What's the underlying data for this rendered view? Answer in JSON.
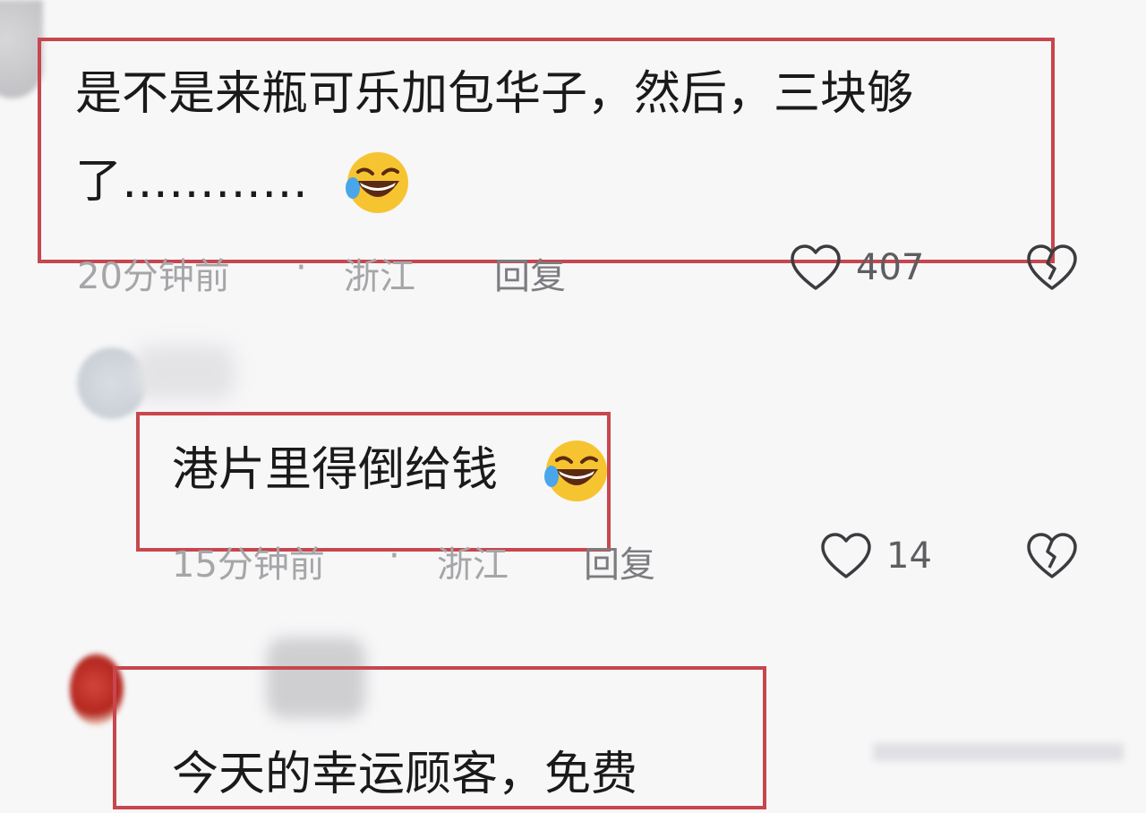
{
  "comments": [
    {
      "text_line1": "是不是来瓶可乐加包华子，然后，三块够",
      "text_line2": "了…………",
      "time": "20分钟前",
      "sep": "·",
      "location": "浙江",
      "reply": "回复",
      "likes": "407",
      "emoji": "laughing-crying-emoji"
    },
    {
      "text": "港片里得倒给钱",
      "time": "15分钟前",
      "sep": "·",
      "location": "浙江",
      "reply": "回复",
      "likes": "14",
      "emoji": "laughing-crying-emoji"
    },
    {
      "text": "今天的幸运顾客，免费"
    }
  ],
  "colors": {
    "highlight": "#c8464d",
    "meta": "#a6a6a9",
    "text": "#1a1a1a"
  },
  "icons": [
    "heart-outline-icon",
    "broken-heart-icon"
  ]
}
